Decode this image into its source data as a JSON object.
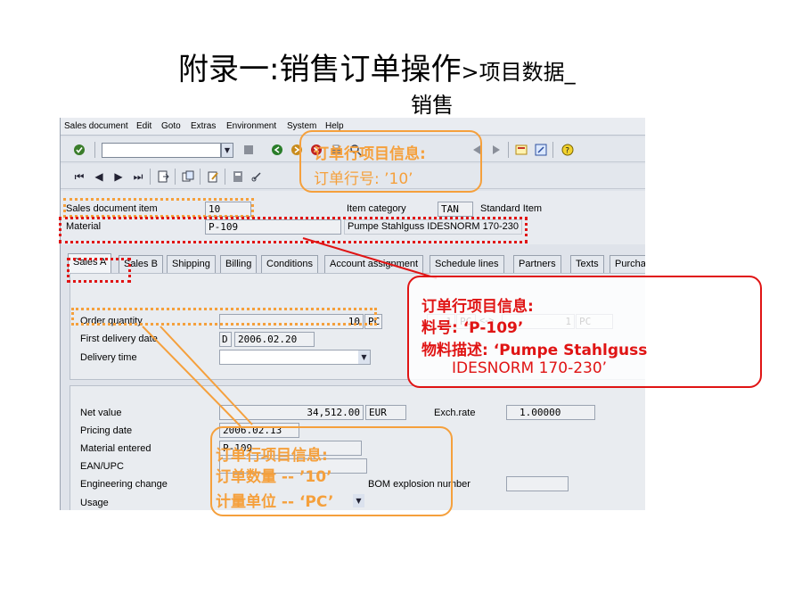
{
  "slide": {
    "title_main": "附录一:销售订单操作",
    "title_small": ">项目数据_",
    "title_line2": "销售"
  },
  "menu": [
    "Sales document",
    "Edit",
    "Goto",
    "Extras",
    "Environment",
    "System",
    "Help"
  ],
  "header": {
    "sales_doc_item_label": "Sales document item",
    "sales_doc_item_value": "10",
    "item_category_label": "Item category",
    "item_category_value": "TAN",
    "item_category_desc": "Standard Item",
    "material_label": "Material",
    "material_value": "P-109",
    "material_desc": "Pumpe Stahlguss IDESNORM 170-230"
  },
  "tabs": [
    "Sales A",
    "Sales B",
    "Shipping",
    "Billing",
    "Conditions",
    "Account assignment",
    "Schedule lines",
    "Partners",
    "Texts",
    "Purcha"
  ],
  "sales_a": {
    "order_quantity_label": "Order quantity",
    "order_quantity_value": "10",
    "order_quantity_unit": "PC",
    "conv_left": "1",
    "conv_left_unit": "PC",
    "conv_sep": "<->",
    "conv_right": "1",
    "conv_right_unit": "PC",
    "first_delivery_label": "First delivery date",
    "first_delivery_format": "D",
    "first_delivery_value": "2006.02.20",
    "delivery_time_label": "Delivery time",
    "net_value_label": "Net value",
    "net_value": "34,512.00",
    "currency": "EUR",
    "exch_rate_label": "Exch.rate",
    "exch_rate_value": "1.00000",
    "pricing_date_label": "Pricing date",
    "pricing_date_value": "2006.02.13",
    "material_entered_label": "Material entered",
    "material_entered_value": "P-109",
    "ean_label": "EAN/UPC",
    "engineering_change_label": "Engineering change",
    "bom_label": "BOM explosion number",
    "usage_label": "Usage"
  },
  "callouts": {
    "top": {
      "line1": "订单行项目信息:",
      "line2": "订单行号: ’10’"
    },
    "right": {
      "line1": "订单行项目信息:",
      "line2": "料号: ‘P-109’",
      "line3": "物料描述: ‘Pumpe Stahlguss",
      "line4": "IDESNORM 170-230’"
    },
    "bottom": {
      "line1": "订单行项目信息:",
      "line2": "订单数量 -- ’10’",
      "line3": "计量单位 -- ‘PC’"
    }
  },
  "colors": {
    "orange": "#f5a03c",
    "red": "#e01414",
    "callout_text_orange": "#f5a03c",
    "callout_text_red": "#e01414"
  }
}
